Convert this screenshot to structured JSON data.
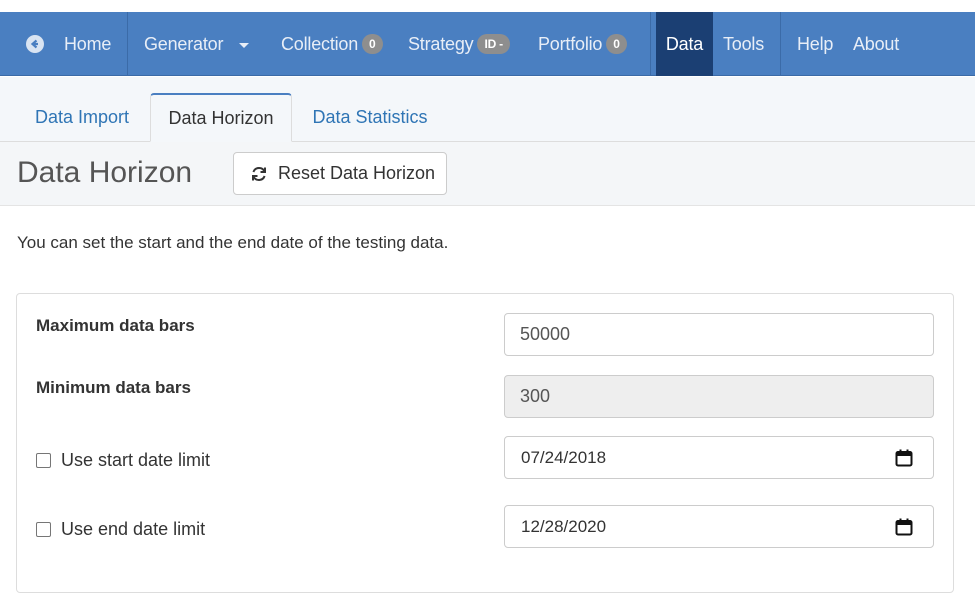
{
  "navbar": {
    "home": "Home",
    "generator": "Generator",
    "collection": {
      "label": "Collection",
      "badge": "0"
    },
    "strategy": {
      "label": "Strategy",
      "badge": "ID -"
    },
    "portfolio": {
      "label": "Portfolio",
      "badge": "0"
    },
    "data": "Data",
    "tools": "Tools",
    "help": "Help",
    "about": "About"
  },
  "tabs": [
    "Data Import",
    "Data Horizon",
    "Data Statistics"
  ],
  "page": {
    "title": "Data Horizon",
    "reset_label": "Reset Data Horizon",
    "description": "You can set the start and the end date of the testing data."
  },
  "form": {
    "max_bars": {
      "label": "Maximum data bars",
      "value": "50000"
    },
    "min_bars": {
      "label": "Minimum data bars",
      "value": "300"
    },
    "start_limit": {
      "label": "Use start date limit",
      "checked": false,
      "date": "07/24/2018"
    },
    "end_limit": {
      "label": "Use end date limit",
      "checked": false,
      "date": "12/28/2020"
    }
  },
  "colors": {
    "navbar": "#4a7fc1",
    "navbar_active": "#1b3f73",
    "link": "#2f75b5",
    "badge": "#8e8e8e"
  }
}
